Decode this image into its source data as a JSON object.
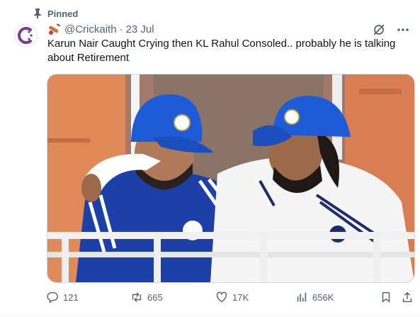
{
  "post": {
    "pinned_label": "Pinned",
    "author_handle": "@Crickaith",
    "separator": "·",
    "date": "23 Jul",
    "text": "Karun Nair Caught Crying then KL Rahul Consoled.. probably he is talking about Retirement"
  },
  "stats": {
    "replies": "121",
    "reposts": "665",
    "likes": "17K",
    "views": "656K"
  },
  "icons": {
    "pin": "pin-icon",
    "bat": "cricket-bat-icon",
    "grok": "grok-icon",
    "more": "more-icon",
    "reply": "reply-icon",
    "repost": "repost-icon",
    "like": "like-icon",
    "views": "views-icon",
    "bookmark": "bookmark-icon",
    "share": "share-icon"
  },
  "colors": {
    "muted": "#536471",
    "text": "#0f1419",
    "avatar_brand": "#7a3e8e",
    "cap_blue": "#1e5bd6"
  }
}
